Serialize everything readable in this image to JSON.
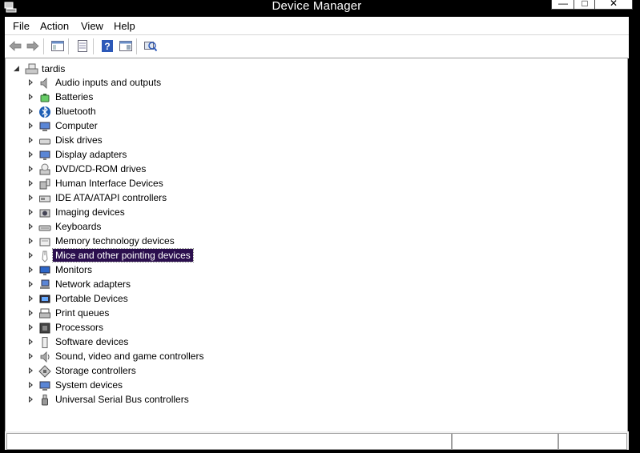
{
  "window": {
    "title": "Device Manager",
    "minimize": "—",
    "maximize": "□",
    "close": "✕"
  },
  "menu": [
    "File",
    "Action",
    "View",
    "Help"
  ],
  "toolbar": [
    "back-icon",
    "forward-icon",
    "show-hide-console-tree-icon",
    "properties-icon",
    "help-icon",
    "action-pane-icon",
    "scan-hardware-icon"
  ],
  "tree": {
    "root": "tardis",
    "nodes": [
      "Audio inputs and outputs",
      "Batteries",
      "Bluetooth",
      "Computer",
      "Disk drives",
      "Display adapters",
      "DVD/CD-ROM drives",
      "Human Interface Devices",
      "IDE ATA/ATAPI controllers",
      "Imaging devices",
      "Keyboards",
      "Memory technology devices",
      "Mice and other pointing devices",
      "Monitors",
      "Network adapters",
      "Portable Devices",
      "Print queues",
      "Processors",
      "Software devices",
      "Sound, video and game controllers",
      "Storage controllers",
      "System devices",
      "Universal Serial Bus controllers"
    ],
    "selected_index": 12
  },
  "colors": {
    "selection": "#2b0f4e",
    "titlebar": "#000000"
  }
}
